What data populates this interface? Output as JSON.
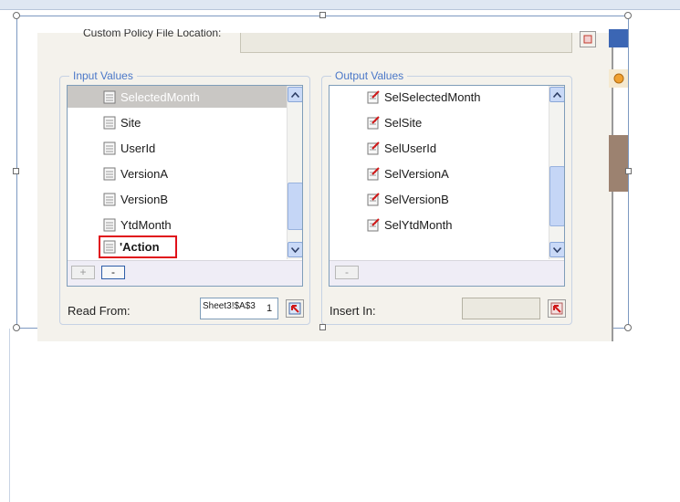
{
  "dialog": {
    "top_label": "Custom Policy File Location:",
    "input_group": {
      "title": "Input Values",
      "items": [
        {
          "label": "SelectedMonth"
        },
        {
          "label": "Site"
        },
        {
          "label": "UserId"
        },
        {
          "label": "VersionA"
        },
        {
          "label": "VersionB"
        },
        {
          "label": "YtdMonth"
        },
        {
          "label": "'Action"
        }
      ],
      "selected_index": 0,
      "add_label": "+",
      "remove_label": "-",
      "read_from_label": "Read From:",
      "read_from_value": "Sheet3!$A$3",
      "cursor_text": "1"
    },
    "output_group": {
      "title": "Output Values",
      "items": [
        {
          "label": "SelSelectedMonth"
        },
        {
          "label": "SelSite"
        },
        {
          "label": "SelUserId"
        },
        {
          "label": "SelVersionA"
        },
        {
          "label": "SelVersionB"
        },
        {
          "label": "SelYtdMonth"
        }
      ],
      "remove_label": "-",
      "insert_in_label": "Insert In:",
      "insert_in_value": ""
    }
  },
  "icons": {
    "doc": "document-icon",
    "doc_edit": "document-edit-icon",
    "range_pick": "range-picker-icon",
    "scroll_up": "arrow-up-icon",
    "scroll_down": "arrow-down-icon"
  },
  "colors": {
    "group_title": "#4a77c8",
    "highlight": "#e0101a",
    "selection": "#c9c7c4",
    "scrollbar": "#c5d6f6"
  }
}
